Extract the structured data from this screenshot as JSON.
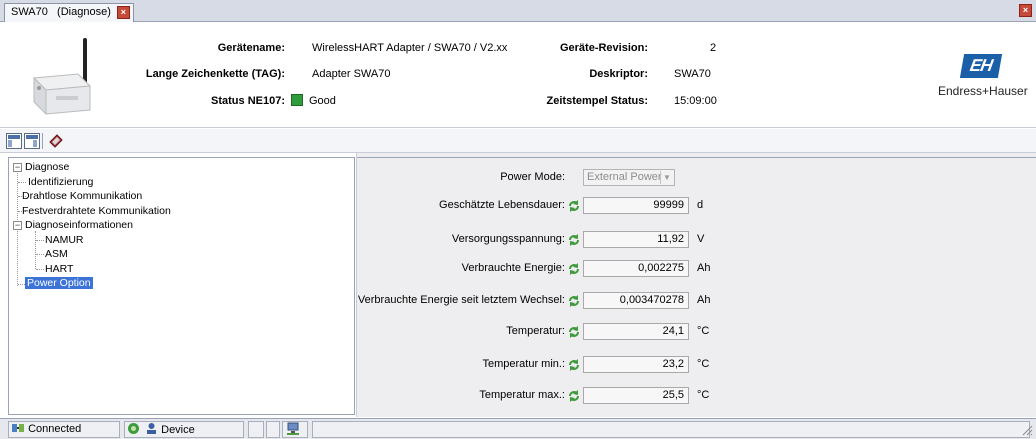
{
  "tab": {
    "label": "SWA70   (Diagnose)",
    "close": "×"
  },
  "window_close": "×",
  "header": {
    "geraetename_label": "Gerätename:",
    "geraetename_value": "WirelessHART Adapter / SWA70 / V2.xx",
    "tag_label": "Lange Zeichenkette (TAG):",
    "tag_value": "Adapter SWA70",
    "status_label": "Status NE107:",
    "status_value": "Good",
    "status_color": "#2e9b3c",
    "revision_label": "Geräte-Revision:",
    "revision_value": "2",
    "deskriptor_label": "Deskriptor:",
    "deskriptor_value": "SWA70",
    "zeitstempel_label": "Zeitstempel Status:",
    "zeitstempel_value": "15:09:00",
    "logo_mark": "EH",
    "logo_text": "Endress+Hauser"
  },
  "tree": {
    "root": "Diagnose",
    "identifizierung": "Identifizierung",
    "drahtlos": "Drahtlose Kommunikation",
    "festverdrahtet": "Festverdrahtete Kommunikation",
    "diagnoseinfo": "Diagnoseinformationen",
    "namur": "NAMUR",
    "asm": "ASM",
    "hart": "HART",
    "power_option": "Power Option"
  },
  "panel": {
    "power_mode_label": "Power Mode:",
    "power_mode_value": "External Power",
    "rows": [
      {
        "label": "Geschätzte Lebensdauer:",
        "value": "99999",
        "unit": "d"
      },
      {
        "label": "Versorgungsspannung:",
        "value": "11,92",
        "unit": "V"
      },
      {
        "label": "Verbrauchte Energie:",
        "value": "0,002275",
        "unit": "Ah"
      },
      {
        "label": "Verbrauchte Energie seit letztem Wechsel:",
        "value": "0,003470278",
        "unit": "Ah"
      },
      {
        "label": "Temperatur:",
        "value": "24,1",
        "unit": "°C"
      },
      {
        "label": "Temperatur min.:",
        "value": "23,2",
        "unit": "°C"
      },
      {
        "label": "Temperatur max.:",
        "value": "25,5",
        "unit": "°C"
      }
    ]
  },
  "statusbar": {
    "connected": "Connected",
    "device": "Device"
  }
}
